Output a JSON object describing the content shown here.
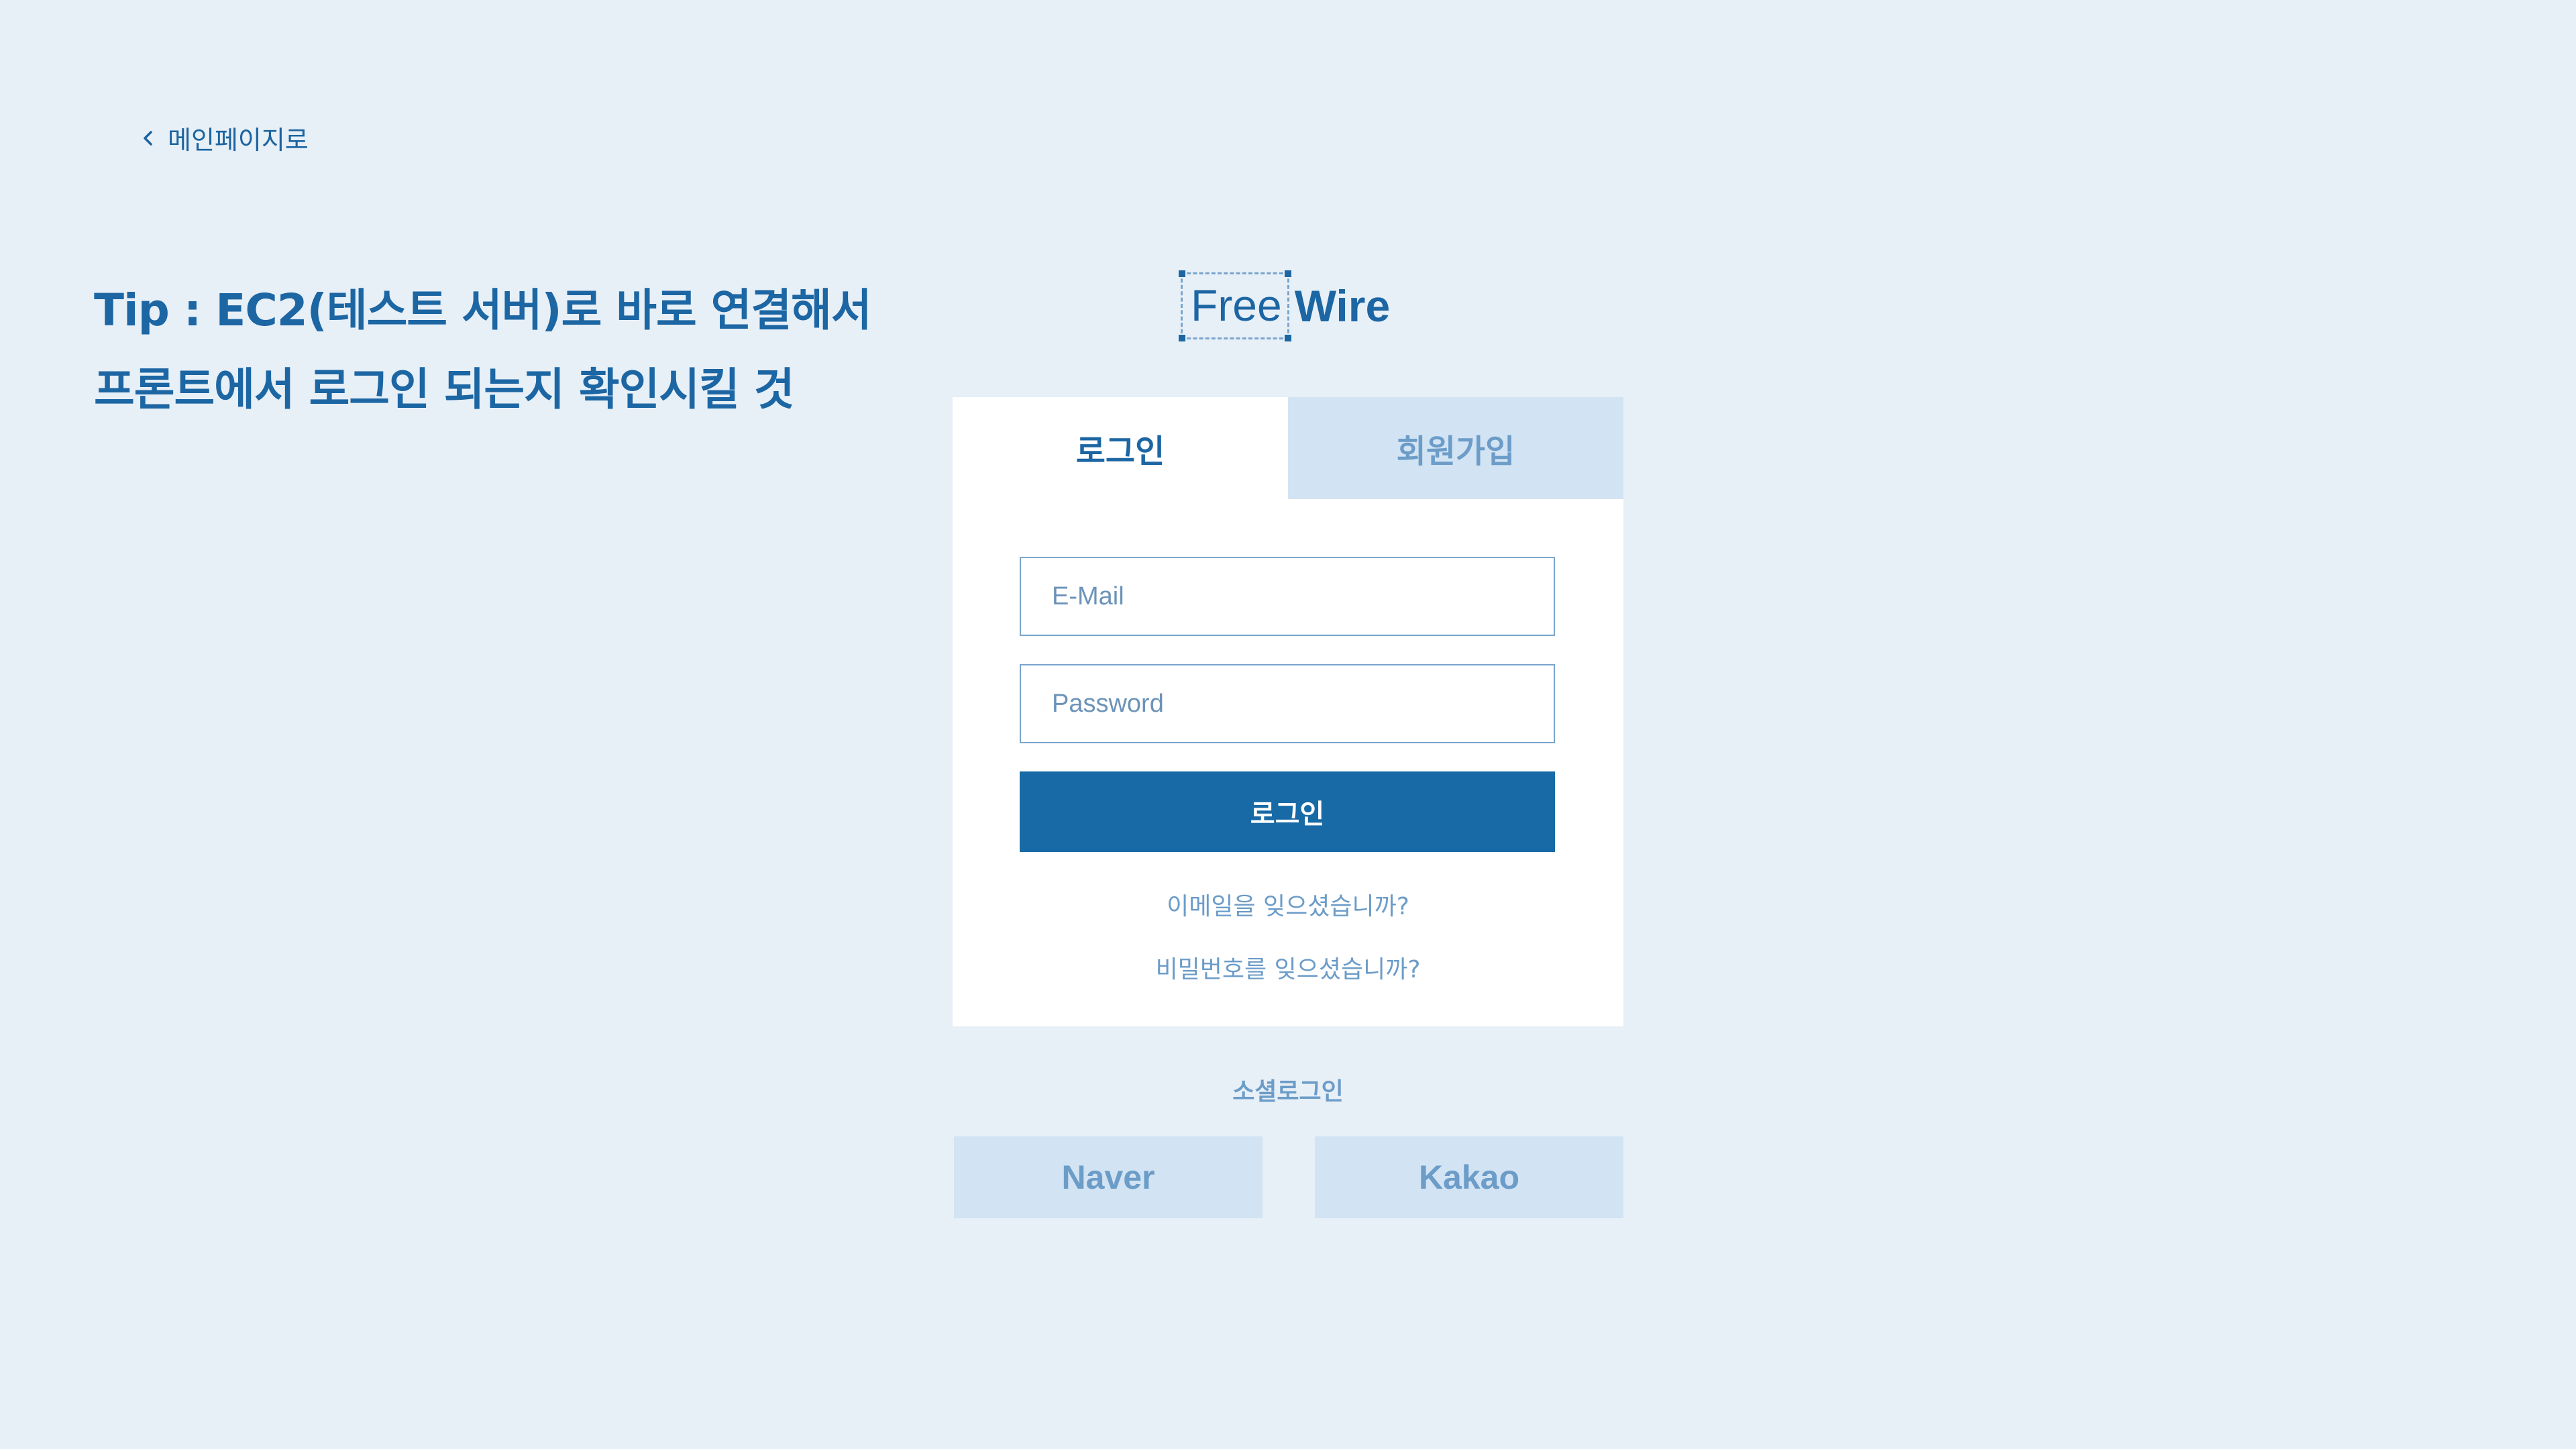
{
  "back_link": {
    "label": "메인페이지로",
    "icon": "chevron-left-icon"
  },
  "tip": {
    "line1": "Tip : EC2(테스트 서버)로 바로 연결해서",
    "line2": "프론트에서 로그인 되는지 확인시킬 것"
  },
  "logo": {
    "part1": "Free",
    "part2": "Wire"
  },
  "tabs": [
    {
      "label": "로그인",
      "active": true
    },
    {
      "label": "회원가입",
      "active": false
    }
  ],
  "form": {
    "email_placeholder": "E-Mail",
    "email_value": "",
    "password_placeholder": "Password",
    "password_value": "",
    "submit_label": "로그인"
  },
  "help_links": {
    "forgot_email": "이메일을 잊으셨습니까?",
    "forgot_password": "비밀번호를 잊으셨습니까?"
  },
  "social": {
    "label": "소셜로그인",
    "buttons": [
      {
        "label": "Naver"
      },
      {
        "label": "Kakao"
      }
    ]
  },
  "colors": {
    "background": "#e7eff7",
    "primary": "#176aa6",
    "muted": "#6c9cc8",
    "tab_inactive_bg": "#d2e3f3"
  }
}
